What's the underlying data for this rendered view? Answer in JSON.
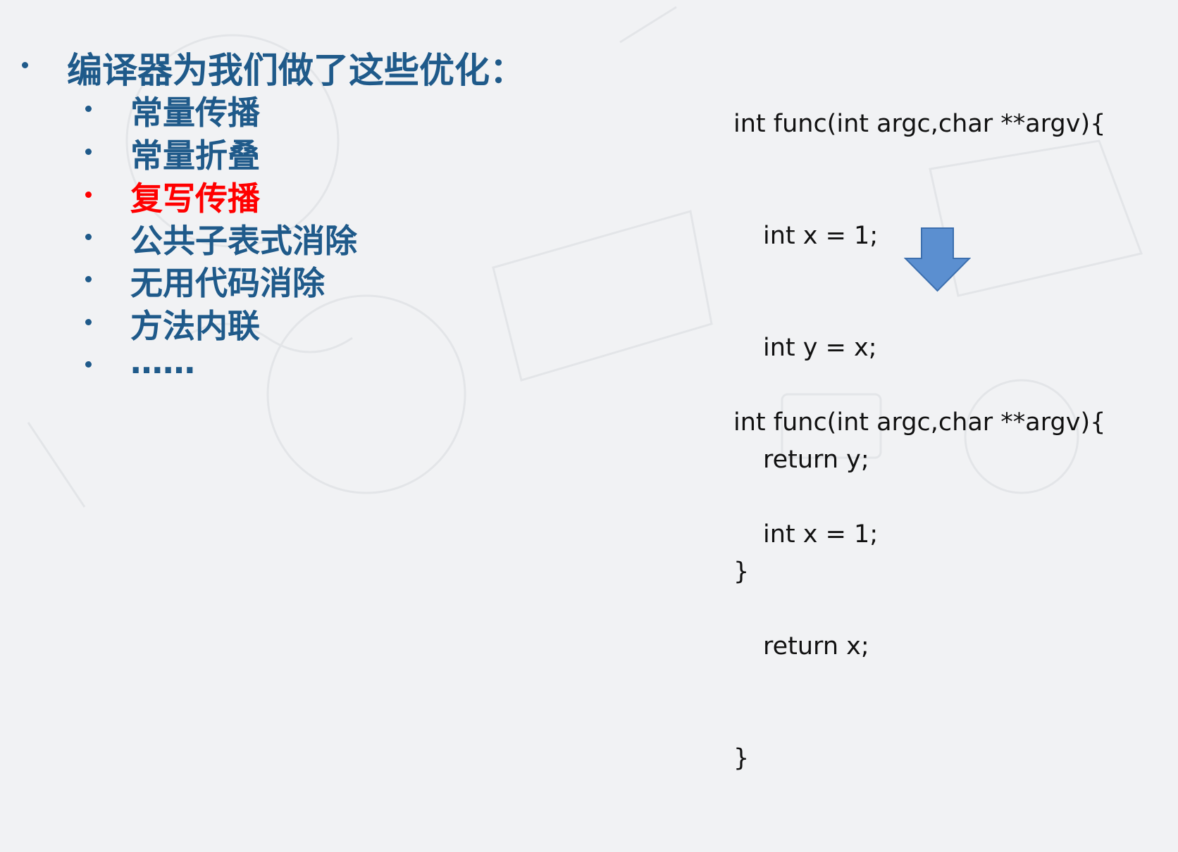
{
  "slide": {
    "heading": "编译器为我们做了这些优化：",
    "items": [
      {
        "label": "常量传播",
        "highlight": false
      },
      {
        "label": "常量折叠",
        "highlight": false
      },
      {
        "label": "复写传播",
        "highlight": true
      },
      {
        "label": "公共子表式消除",
        "highlight": false
      },
      {
        "label": "无用代码消除",
        "highlight": false
      },
      {
        "label": "方法内联",
        "highlight": false
      },
      {
        "label": "……",
        "highlight": false
      }
    ]
  },
  "code_before": [
    "int func(int argc,char **argv){",
    "int x = 1;",
    "int y = x;",
    "return y;",
    "}"
  ],
  "code_after": [
    "int func(int argc,char **argv){",
    "int x = 1;",
    "return x;",
    "}"
  ],
  "arrow_icon": "down-arrow-icon",
  "colors": {
    "heading": "#1f5a8a",
    "highlight": "#ff0000",
    "arrow_fill": "#5b8fd0",
    "arrow_stroke": "#3c6fae"
  }
}
